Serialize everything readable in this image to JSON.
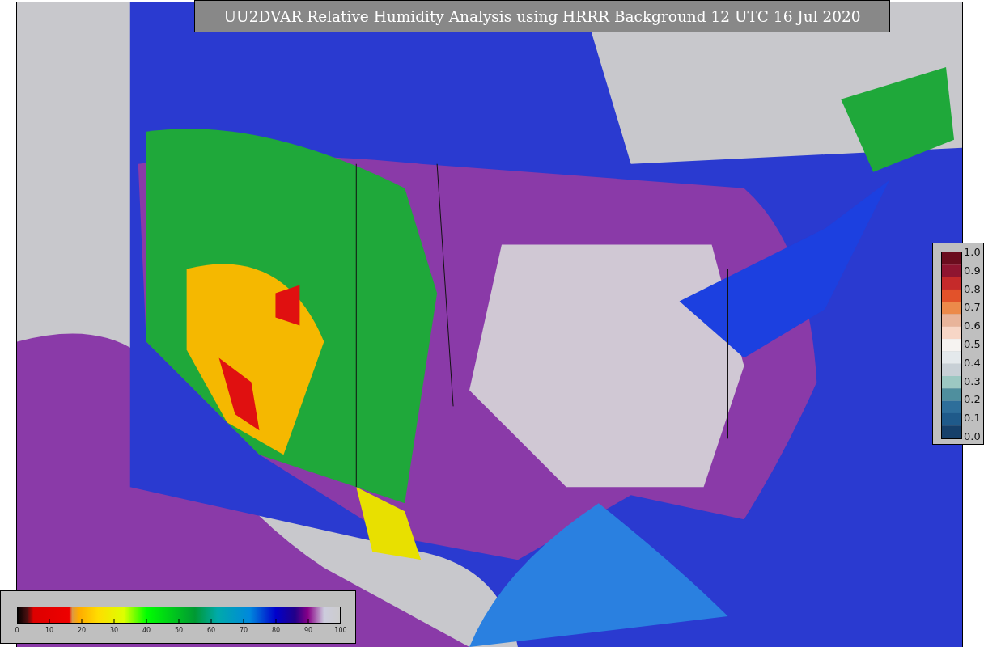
{
  "title": "UU2DVAR Relative Humidity Analysis using HRRR Background 12 UTC 16 Jul 2020",
  "humidity_scale": {
    "ticks": [
      "0",
      "10",
      "20",
      "30",
      "40",
      "50",
      "60",
      "70",
      "80",
      "90",
      "100"
    ]
  },
  "observation_scale": {
    "ticks": [
      "1.0",
      "0.9",
      "0.8",
      "0.7",
      "0.6",
      "0.5",
      "0.4",
      "0.3",
      "0.2",
      "0.1",
      "0.0"
    ]
  }
}
